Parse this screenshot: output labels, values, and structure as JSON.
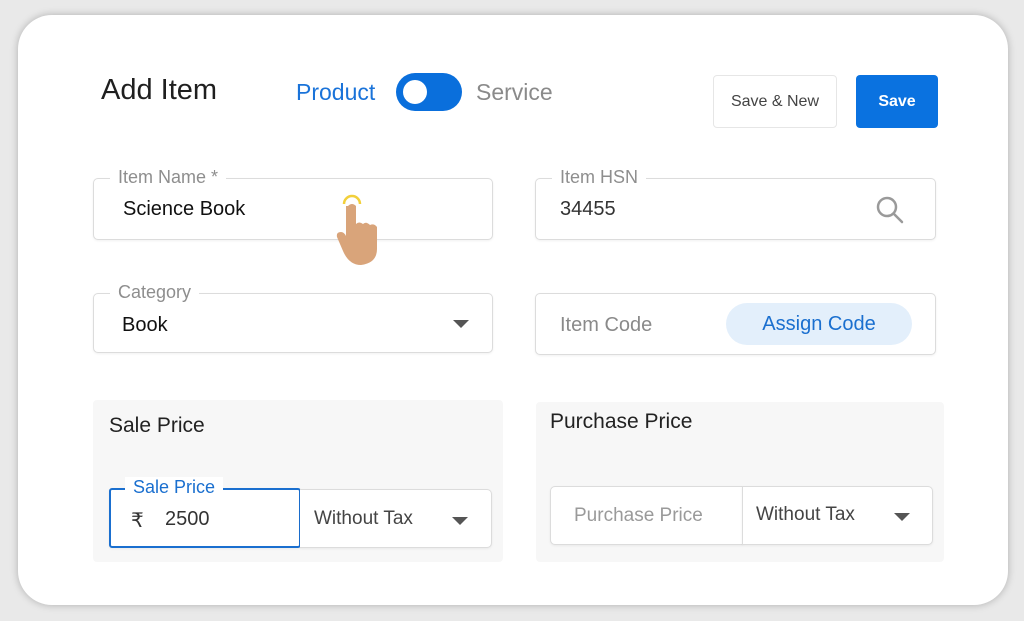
{
  "header": {
    "title": "Add Item",
    "toggle": {
      "left_label": "Product",
      "right_label": "Service",
      "selected": "Product"
    },
    "save_new_label": "Save & New",
    "save_label": "Save"
  },
  "form": {
    "item_name": {
      "label": "Item Name *",
      "value": "Science Book"
    },
    "item_hsn": {
      "label": "Item HSN",
      "value": "34455",
      "icon": "search-icon"
    },
    "category": {
      "label": "Category",
      "value": "Book"
    },
    "item_code": {
      "placeholder": "Item Code",
      "assign_label": "Assign Code"
    }
  },
  "sale_price": {
    "title": "Sale Price",
    "input_label": "Sale Price",
    "currency": "₹",
    "value": "2500",
    "tax_option": "Without Tax"
  },
  "purchase_price": {
    "title": "Purchase Price",
    "placeholder": "Purchase Price",
    "tax_option": "Without Tax"
  },
  "colors": {
    "accent": "#0a72e0",
    "assign_bg": "#e3effb"
  }
}
